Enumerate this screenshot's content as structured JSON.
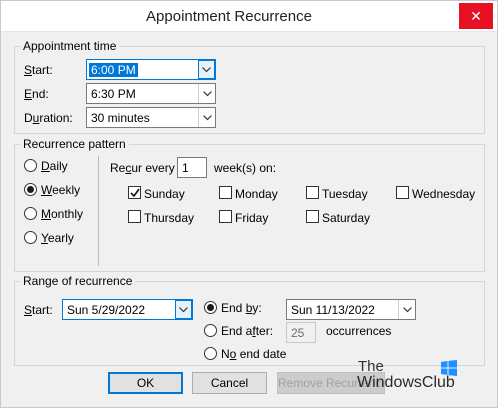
{
  "window": {
    "title": "Appointment Recurrence",
    "close_glyph": "✕"
  },
  "appointment_time": {
    "legend": "Appointment time",
    "start": {
      "label_prefix": "",
      "label_key": "S",
      "label_rest": "tart:",
      "value": "6:00 PM"
    },
    "end": {
      "label_key": "E",
      "label_rest": "nd:",
      "value": "6:30 PM"
    },
    "duration": {
      "label_pre": "D",
      "label_key": "u",
      "label_rest": "ration:",
      "value": "30 minutes"
    }
  },
  "recurrence_pattern": {
    "legend": "Recurrence pattern",
    "options": [
      {
        "key": "D",
        "rest": "aily",
        "selected": false
      },
      {
        "key": "W",
        "rest": "eekly",
        "selected": true
      },
      {
        "key": "M",
        "rest": "onthly",
        "selected": false
      },
      {
        "key": "Y",
        "rest": "early",
        "selected": false
      }
    ],
    "recur_every_pre": "Re",
    "recur_every_key": "c",
    "recur_every_rest": "ur every",
    "interval_value": "1",
    "interval_suffix": "week(s) on:",
    "days": [
      {
        "label": "Sunday",
        "checked": true
      },
      {
        "label": "Monday",
        "checked": false
      },
      {
        "label": "Tuesday",
        "checked": false
      },
      {
        "label": "Wednesday",
        "checked": false
      },
      {
        "label": "Thursday",
        "checked": false
      },
      {
        "label": "Friday",
        "checked": false
      },
      {
        "label": "Saturday",
        "checked": false
      }
    ]
  },
  "range_of_recurrence": {
    "legend": "Range of recurrence",
    "start": {
      "label_key": "S",
      "label_rest": "tart:",
      "value": "Sun 5/29/2022"
    },
    "end_by": {
      "label_pre": "End ",
      "label_key": "b",
      "label_rest": "y:",
      "value": "Sun 11/13/2022",
      "selected": true
    },
    "end_after": {
      "label_pre": "End a",
      "label_key": "f",
      "label_rest": "ter:",
      "value": "25",
      "suffix": "occurrences",
      "selected": false
    },
    "no_end": {
      "label_pre": "N",
      "label_key": "o",
      "label_rest": " end date",
      "selected": false
    }
  },
  "buttons": {
    "ok": "OK",
    "cancel": "Cancel",
    "remove": "Remove Recurrence"
  },
  "watermark": {
    "line1": "The",
    "line2": "WindowsClub"
  },
  "colors": {
    "accent": "#0078d7",
    "close": "#e81123",
    "dialog_bg": "#f0f0f0"
  }
}
